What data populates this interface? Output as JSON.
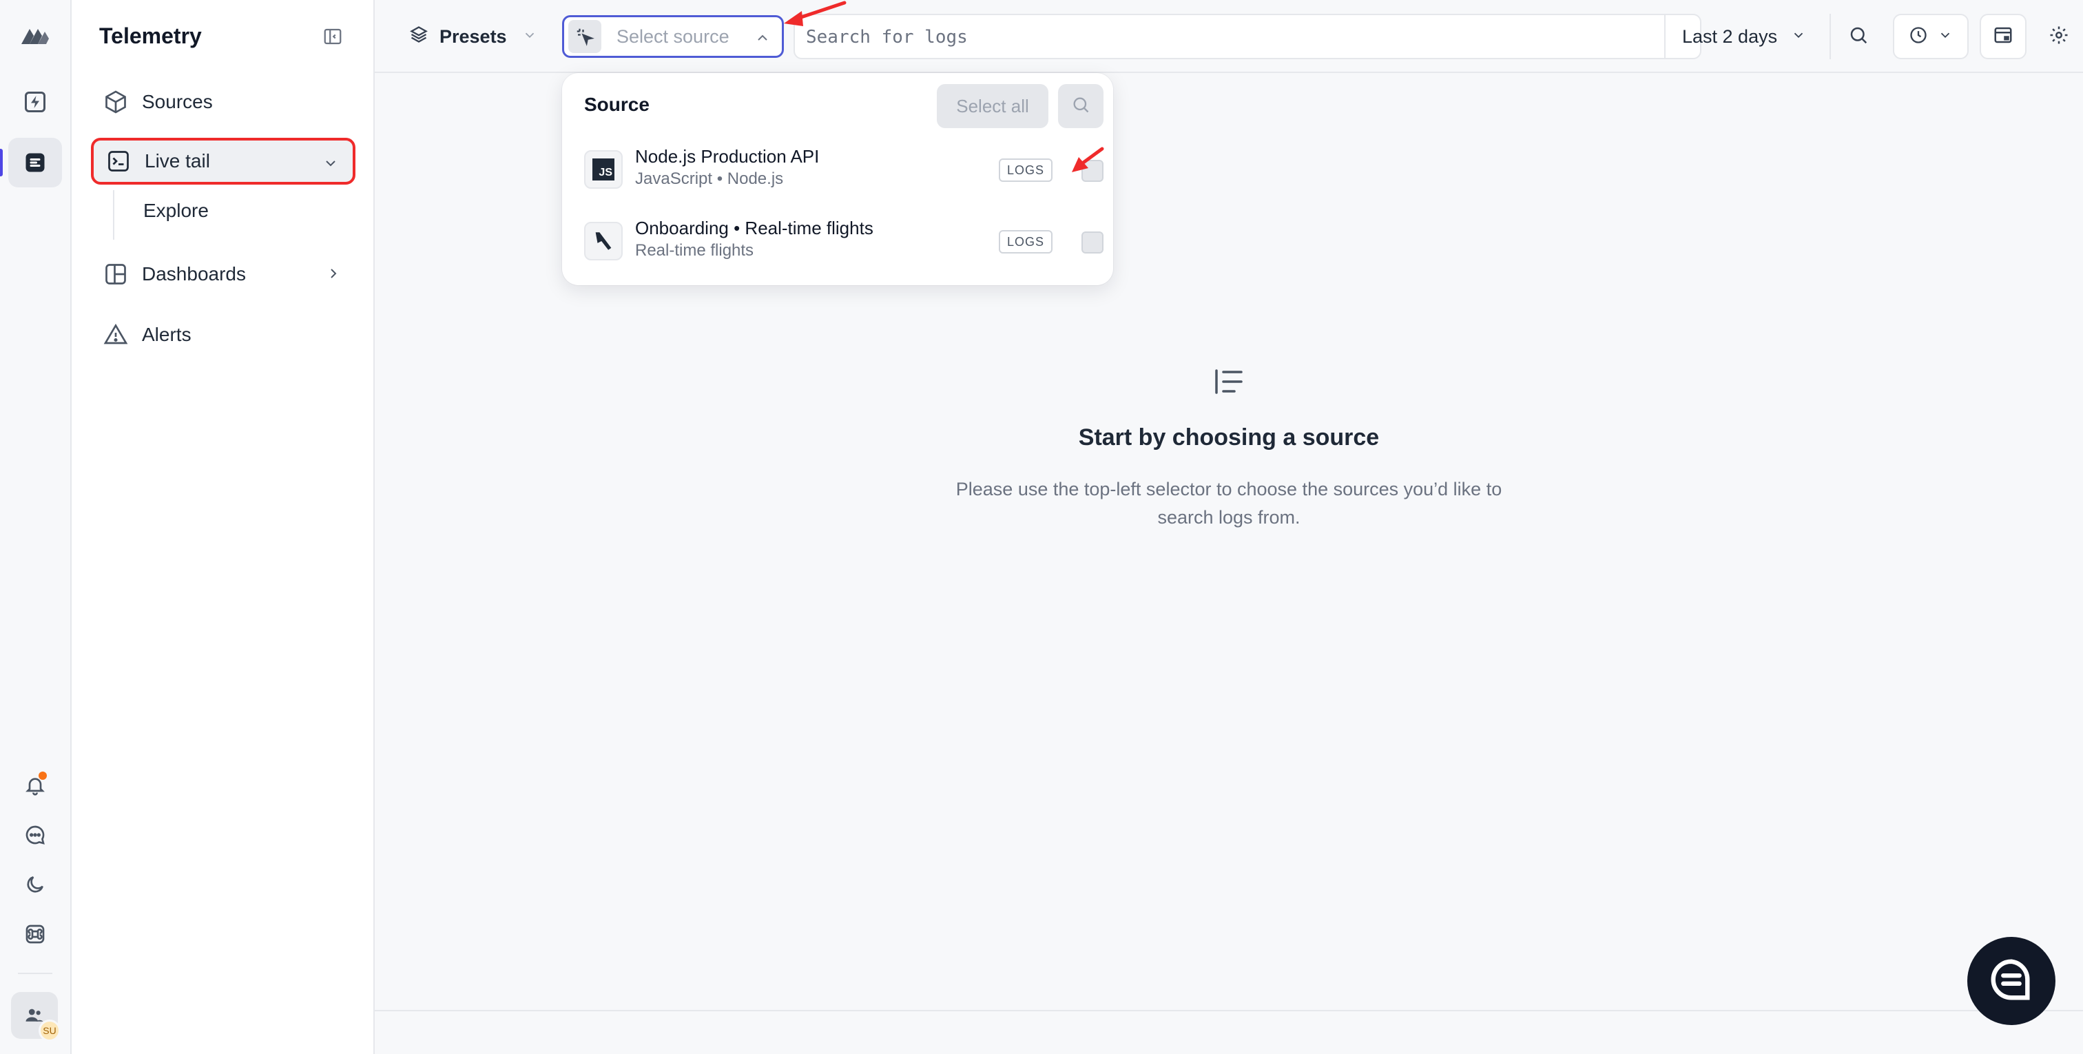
{
  "sidebar": {
    "title": "Telemetry",
    "items": [
      {
        "label": "Sources",
        "icon": "cube-icon"
      },
      {
        "label": "Live tail",
        "icon": "terminal-icon"
      },
      {
        "label": "Explore"
      },
      {
        "label": "Dashboards",
        "icon": "dashboard-icon"
      },
      {
        "label": "Alerts",
        "icon": "alert-triangle-icon"
      }
    ]
  },
  "rail": {
    "avatar_initials": "SU"
  },
  "toolbar": {
    "presets_label": "Presets",
    "select_source_label": "Select source",
    "search_placeholder": "Search for logs",
    "time_range": "Last 2 days"
  },
  "source_dropdown": {
    "title": "Source",
    "select_all_label": "Select all",
    "sources": [
      {
        "name": "Node.js Production API",
        "subtitle": "JavaScript • Node.js",
        "tag": "LOGS",
        "icon_text": "JS"
      },
      {
        "name": "Onboarding • Real-time flights",
        "subtitle": "Real-time flights",
        "tag": "LOGS"
      }
    ]
  },
  "empty_state": {
    "title": "Start by choosing a source",
    "description": "Please use the top-left selector to choose the sources you’d like to search logs from."
  },
  "colors": {
    "accent": "#4f5bd5",
    "highlight_border": "#ef2b2b",
    "notification_dot": "#f97316",
    "fab": "#111827"
  }
}
